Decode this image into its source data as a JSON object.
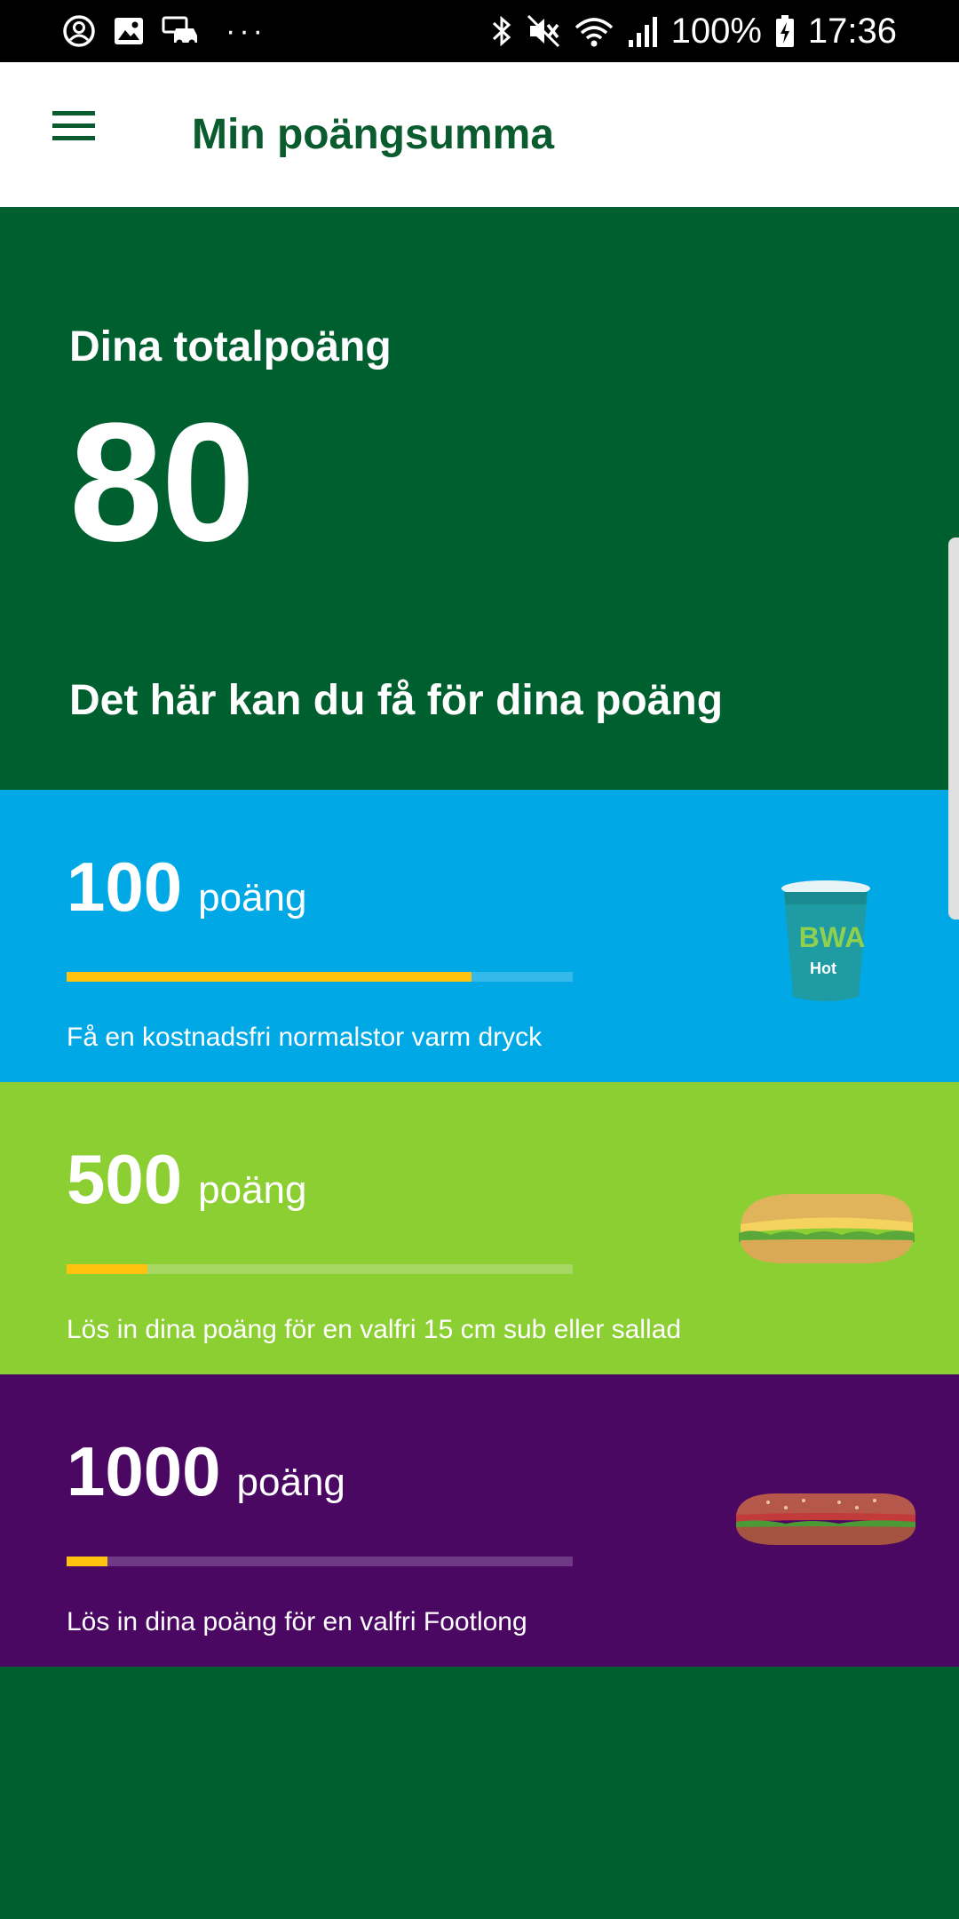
{
  "status_bar": {
    "battery": "100%",
    "time": "17:36",
    "dots": "···"
  },
  "app_bar": {
    "title": "Min poängsumma"
  },
  "summary": {
    "total_label": "Dina totalpoäng",
    "total_points": "80",
    "rewards_heading": "Det här kan du få för dina poäng"
  },
  "rewards": [
    {
      "points": "100",
      "unit": "poäng",
      "progress": 0.8,
      "description": "Få en kostnadsfri normalstor varm dryck",
      "image": "hot-drink-cup-image",
      "cup_brand": "BWA",
      "cup_label": "Hot"
    },
    {
      "points": "500",
      "unit": "poäng",
      "progress": 0.16,
      "description": "Lös in dina poäng för en valfri 15 cm sub eller sallad",
      "image": "sub-sandwich-image"
    },
    {
      "points": "1000",
      "unit": "poäng",
      "progress": 0.08,
      "description": "Lös in dina poäng för en valfri Footlong",
      "image": "footlong-sandwich-image"
    }
  ],
  "colors": {
    "brand_green": "#005f2f",
    "title_green": "#0a5c2f",
    "drink_card": "#00a8e6",
    "sub_card": "#8ccf33",
    "footlong_card": "#4b0863",
    "progress_fill": "#ffc20e"
  }
}
